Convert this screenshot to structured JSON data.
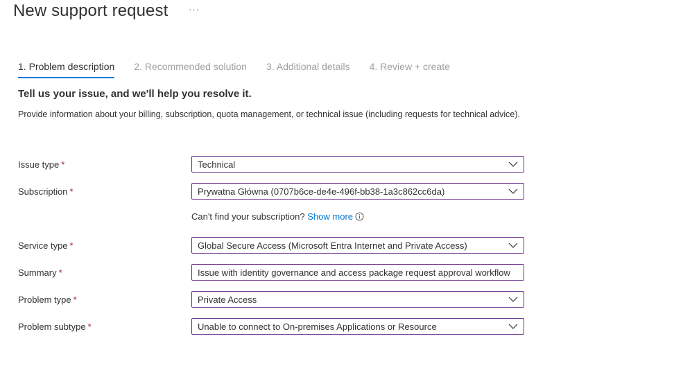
{
  "header": {
    "title": "New support request",
    "more_label": "···"
  },
  "tabs": [
    {
      "label": "1. Problem description"
    },
    {
      "label": "2. Recommended solution"
    },
    {
      "label": "3. Additional details"
    },
    {
      "label": "4. Review + create"
    }
  ],
  "form": {
    "heading": "Tell us your issue, and we'll help you resolve it.",
    "description": "Provide information about your billing, subscription, quota management, or technical issue (including requests for technical advice).",
    "required_marker": "*",
    "issue_type": {
      "label": "Issue type",
      "value": "Technical"
    },
    "subscription": {
      "label": "Subscription",
      "value": "Prywatna Główna (0707b6ce-de4e-496f-bb38-1a3c862cc6da)"
    },
    "subscription_hint": {
      "text": "Can't find your subscription?",
      "link": "Show more"
    },
    "service_type": {
      "label": "Service type",
      "value": "Global Secure Access (Microsoft Entra Internet and Private Access)"
    },
    "summary": {
      "label": "Summary",
      "value": "Issue with identity governance and access package request approval workflow"
    },
    "problem_type": {
      "label": "Problem type",
      "value": "Private Access"
    },
    "problem_subtype": {
      "label": "Problem subtype",
      "value": "Unable to connect to On-premises Applications or Resource"
    }
  },
  "colors": {
    "accent": "#0078d4",
    "field_border": "#6b2e8c",
    "required": "#a4262c"
  }
}
